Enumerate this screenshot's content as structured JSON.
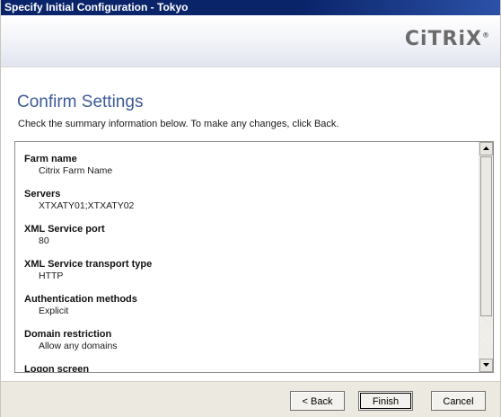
{
  "window": {
    "title": "Specify Initial Configuration - Tokyo"
  },
  "banner": {
    "logo_text": "CiTRiX",
    "logo_mark": "®"
  },
  "page": {
    "title": "Confirm Settings",
    "subtitle": "Check the summary information below. To make any changes, click Back."
  },
  "summary": {
    "items": [
      {
        "label": "Farm name",
        "value": "Citrix Farm Name"
      },
      {
        "label": "Servers",
        "value": "XTXATY01;XTXATY02"
      },
      {
        "label": "XML Service port",
        "value": "80"
      },
      {
        "label": "XML Service transport type",
        "value": "HTTP"
      },
      {
        "label": "Authentication methods",
        "value": "Explicit"
      },
      {
        "label": "Domain restriction",
        "value": "Allow any domains"
      },
      {
        "label": "Logon screen",
        "value": ""
      }
    ]
  },
  "buttons": {
    "back": "< Back",
    "finish": "Finish",
    "cancel": "Cancel"
  },
  "icons": {
    "scroll_up": "arrow-up-icon",
    "scroll_down": "arrow-down-icon"
  }
}
